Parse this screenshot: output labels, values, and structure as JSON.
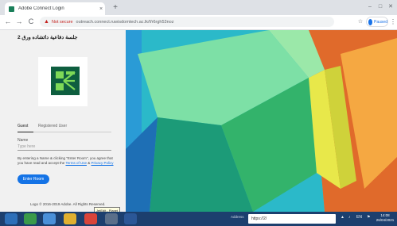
{
  "browser": {
    "tab_title": "Adobe Connect Login",
    "tab_close": "×",
    "new_tab": "+",
    "window_controls": [
      "–",
      "□",
      "✕"
    ],
    "nav": {
      "back": "←",
      "forward": "→",
      "reload": "C"
    },
    "security_label": "Not secure",
    "url": "outreach.connect.ruwisdomtech.ac.lk/f/r6rgh53noz",
    "profile_label": "Paused",
    "icons": [
      "favicon",
      "warning-icon",
      "star-icon",
      "avatar-icon",
      "menu-icon"
    ]
  },
  "login": {
    "room_title": "جلسة دفاعية دائشاده ورق 2",
    "tabs": {
      "guest": "Guest",
      "registered": "Registered User"
    },
    "name_label": "Name",
    "name_placeholder": "Type here",
    "terms_prefix": "By entering a Name & clicking \"Enter Room\", you agree that you have read and accept the ",
    "terms_link": "Terms of Use",
    "terms_mid": " & ",
    "privacy_link": "Privacy Policy",
    "enter_button": "Enter Room",
    "copyright": "Logo © 2016-2019 Adobe. All Rights Reserved.",
    "tooltip": "JetEdit - Planet"
  },
  "taskbar": {
    "address_label": "Address",
    "search_text": "https://2/",
    "tray_items": [
      "▲",
      "♪",
      "EN",
      "⚑"
    ],
    "clock_time": "14:08",
    "clock_date": "26/04/2021"
  },
  "colors": {
    "accent": "#1473e6",
    "logo": "#0e5e3f",
    "taskbar": "#1c3f6e"
  }
}
